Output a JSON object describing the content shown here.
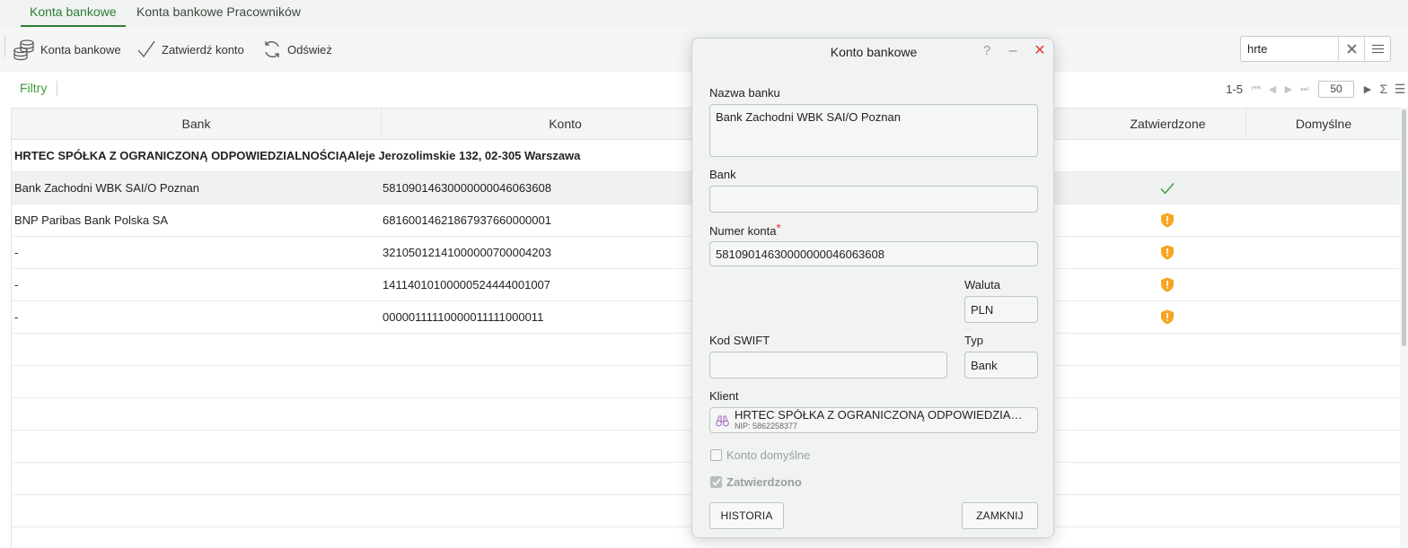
{
  "tabs": [
    {
      "label": "Konta bankowe",
      "active": true
    },
    {
      "label": "Konta bankowe Pracowników",
      "active": false
    }
  ],
  "toolbar": {
    "accounts_label": "Konta bankowe",
    "confirm_label": "Zatwierdź konto",
    "refresh_label": "Odśwież"
  },
  "search": {
    "value": "hrte"
  },
  "filters": {
    "label": "Filtry"
  },
  "pager": {
    "range": "1-5",
    "page_size": "50"
  },
  "grid": {
    "columns": [
      "Bank",
      "Konto",
      "Zatwierdzone",
      "Domyślne"
    ],
    "group_header": "HRTEC SPÓŁKA Z OGRANICZONĄ ODPOWIEDZIALNOŚCIĄAleje Jerozolimskie 132, 02-305 Warszawa",
    "rows": [
      {
        "bank": "Bank Zachodni WBK SAI/O Poznan",
        "konto": "58109014630000000046063608",
        "status": "approved"
      },
      {
        "bank": "BNP Paribas Bank Polska SA",
        "konto": "68160014621867937660000001",
        "status": "warning"
      },
      {
        "bank": "-",
        "konto": "32105012141000000700004203",
        "status": "warning"
      },
      {
        "bank": "-",
        "konto": "14114010100000524444001007",
        "status": "warning"
      },
      {
        "bank": "-",
        "konto": "00000111110000011111000011",
        "status": "warning"
      }
    ]
  },
  "dialog": {
    "title": "Konto bankowe",
    "help": "?",
    "minimize": "–",
    "close": "✕",
    "bank_name_label": "Nazwa banku",
    "bank_name_value": "Bank Zachodni WBK SAI/O Poznan",
    "bank_label": "Bank",
    "bank_value": "",
    "account_label": "Numer konta",
    "required_mark": "*",
    "account_value": "58109014630000000046063608",
    "currency_label": "Waluta",
    "currency_value": "PLN",
    "swift_label": "Kod SWIFT",
    "swift_value": "",
    "type_label": "Typ",
    "type_value": "Bank",
    "client_label": "Klient",
    "client_name": "HRTEC SPÓŁKA Z OGRANICZONĄ ODPOWIEDZIALNOŚCIĄ",
    "client_nip": "NIP: 5862258377",
    "default_label": "Konto domyślne",
    "default_checked": false,
    "approved_label": "Zatwierdzono",
    "approved_checked": true,
    "history_button": "HISTORIA",
    "close_button": "ZAMKNIJ"
  },
  "colors": {
    "accent_green": "#2e7d32",
    "warning_orange": "#f5a623",
    "close_red": "#e53935"
  }
}
